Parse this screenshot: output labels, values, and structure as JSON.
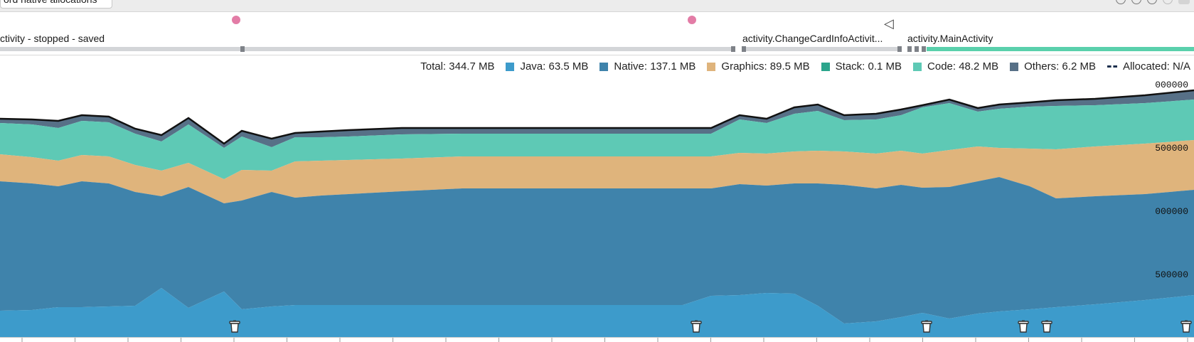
{
  "toolbar": {
    "record_button": "ord native allocations"
  },
  "events": {
    "activities": [
      {
        "label": "ctivity - stopped - saved"
      },
      {
        "label": "activity.ChangeCardInfoActivit..."
      },
      {
        "label": "activity.MainActivity"
      }
    ],
    "markers": [
      "touch-event",
      "touch-event"
    ]
  },
  "legend": {
    "total": "Total: 344.7 MB",
    "java": "Java: 63.5 MB",
    "native": "Native: 137.1 MB",
    "graphics": "Graphics: 89.5 MB",
    "stack": "Stack: 0.1 MB",
    "code": "Code: 48.2 MB",
    "others": "Others: 6.2 MB",
    "allocated": "Allocated: N/A"
  },
  "colors": {
    "java": "#3d9bcb",
    "native": "#3f83ab",
    "graphics": "#dfb47c",
    "stack": "#2ba58c",
    "code": "#5ec9b5",
    "others": "#577087",
    "allocated": "#1c2f4d"
  },
  "chart_data": {
    "type": "area",
    "y_tick_labels": [
      "000000",
      "500000",
      "000000",
      "500000"
    ],
    "stacked_series_order": [
      "java",
      "native",
      "graphics",
      "code",
      "others"
    ]
  }
}
